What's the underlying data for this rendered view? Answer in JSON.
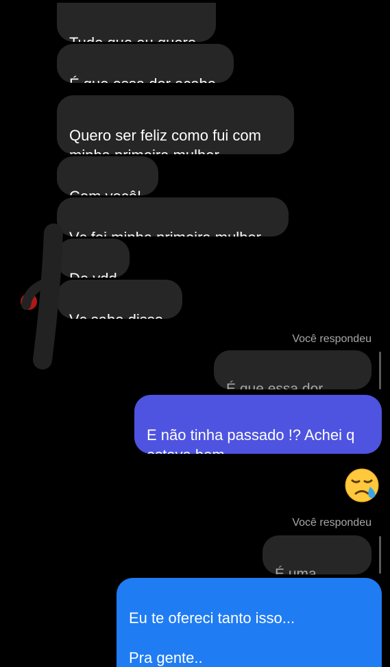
{
  "incoming": [
    {
      "name": "msg-tudo",
      "text": "Tudo que eu quero"
    },
    {
      "name": "msg-dor",
      "text": "É que essa dor acabe"
    },
    {
      "name": "msg-feliz",
      "text": "Quero ser feliz como fui com\nminha primeira mulher"
    },
    {
      "name": "msg-com-voce",
      "text": "Com você!"
    },
    {
      "name": "msg-primeira",
      "text": "Vc foi minha primeira mulher"
    },
    {
      "name": "msg-de-vdd",
      "text": "De vdd"
    },
    {
      "name": "msg-sabe",
      "text": "Vc sabe disso"
    }
  ],
  "replies": [
    {
      "label": "Você respondeu",
      "quote": "É que essa dor acabe"
    },
    {
      "label": "Você respondeu",
      "quote": "É uma família"
    }
  ],
  "outgoing": [
    {
      "text": "E não tinha passado !? Achei q\nestava bem",
      "color": "#4e53e0"
    },
    {
      "text": "Eu te ofereci tanto isso...\n\nPra gente..",
      "color": "#1f7cf3"
    }
  ],
  "emoji": {
    "icon": "crying-face-emoji",
    "char": "😪"
  }
}
